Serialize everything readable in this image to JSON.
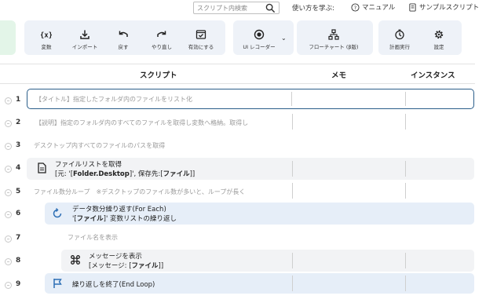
{
  "search": {
    "placeholder": "スクリプト内検索"
  },
  "top_links": {
    "learn_label": "使い方を学ぶ:",
    "manual": "マニュアル",
    "samples": "サンプルスクリプト"
  },
  "toolbar": {
    "buttons": [
      {
        "label": "変数",
        "icon": "variable-icon"
      },
      {
        "label": "インポート",
        "icon": "import-icon"
      },
      {
        "label": "戻す",
        "icon": "undo-icon"
      },
      {
        "label": "やり直し",
        "icon": "redo-icon"
      },
      {
        "label": "有効にする",
        "icon": "enable-icon"
      },
      {
        "label": "UI レコーダー",
        "icon": "record-icon"
      },
      {
        "label": "フローチャート (β版)",
        "icon": "flowchart-icon"
      },
      {
        "label": "計画実行",
        "icon": "schedule-icon"
      },
      {
        "label": "設定",
        "icon": "settings-gear-icon"
      }
    ]
  },
  "table": {
    "headers": {
      "script": "スクリプト",
      "memo": "メモ",
      "instance": "インスタンス"
    },
    "rows": [
      {
        "num": "1",
        "kind": "comment",
        "text": "【タイトル】指定したフォルダ内のファイルをリスト化"
      },
      {
        "num": "2",
        "kind": "comment",
        "text": "【説明】指定のフォルダ内のすべてのファイルを取得し変数へ格納。取得し"
      },
      {
        "num": "3",
        "kind": "comment",
        "text": "デスクトップ内すべてのファイルのパスを取得"
      },
      {
        "num": "4",
        "kind": "command",
        "title": "ファイルリストを取得",
        "sub_a": "[元: '[",
        "sub_b": "Folder.Desktop",
        "sub_c": "]', 保存先:[",
        "sub_d": "ファイル",
        "sub_e": "]]"
      },
      {
        "num": "5",
        "kind": "comment",
        "text": "ファイル数分ループ　※デスクトップのファイル数が多いと、ループが長く"
      },
      {
        "num": "6",
        "kind": "loop",
        "title": "データ数分繰り返す(For Each)",
        "sub_a": "'[",
        "sub_b": "ファイル",
        "sub_c": "]' 変数リストの繰り返し"
      },
      {
        "num": "7",
        "kind": "comment",
        "text": "ファイル名を表示"
      },
      {
        "num": "8",
        "kind": "command",
        "title": "メッセージを表示",
        "sub_a": "[メッセージ: [",
        "sub_b": "ファイル",
        "sub_c": "]]"
      },
      {
        "num": "9",
        "kind": "loop-end",
        "title": "繰り返しを終了(End Loop)"
      }
    ]
  }
}
